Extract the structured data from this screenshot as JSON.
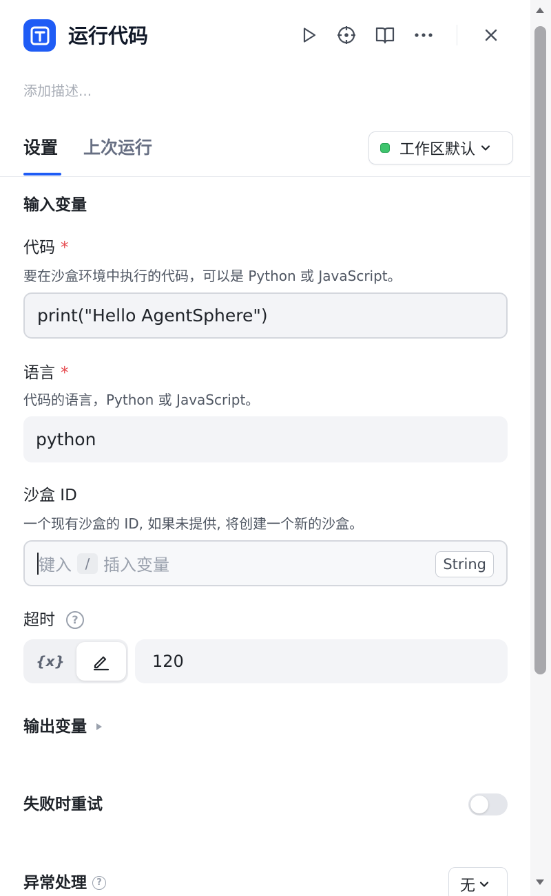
{
  "header": {
    "title": "运行代码",
    "description_placeholder": "添加描述..."
  },
  "tabs": [
    {
      "label": "设置",
      "active": true
    },
    {
      "label": "上次运行",
      "active": false
    }
  ],
  "workspace_select": {
    "label": "工作区默认",
    "status_color": "#3ec46d"
  },
  "inputs": {
    "section_title": "输入变量",
    "code": {
      "label": "代码",
      "required_mark": "*",
      "hint": "要在沙盒环境中执行的代码，可以是 Python 或 JavaScript。",
      "value": "print(\"Hello AgentSphere\")"
    },
    "language": {
      "label": "语言",
      "required_mark": "*",
      "hint": "代码的语言，Python 或 JavaScript。",
      "value": "python"
    },
    "sandbox_id": {
      "label": "沙盒 ID",
      "hint": "一个现有沙盒的 ID, 如果未提供, 将创建一个新的沙盒。",
      "placeholder_prefix": "键入",
      "placeholder_slash": "/",
      "placeholder_suffix": "插入变量",
      "type_tag": "String"
    },
    "timeout": {
      "label": "超时",
      "help_icon": "?",
      "var_mode_label": "{x}",
      "value": "120"
    }
  },
  "outputs": {
    "section_title": "输出变量"
  },
  "retry": {
    "label": "失败时重试",
    "enabled": false
  },
  "exception": {
    "label": "异常处理",
    "help_icon": "?",
    "value": "无"
  },
  "colors": {
    "accent": "#1f5cf5",
    "required": "#e5484d"
  }
}
